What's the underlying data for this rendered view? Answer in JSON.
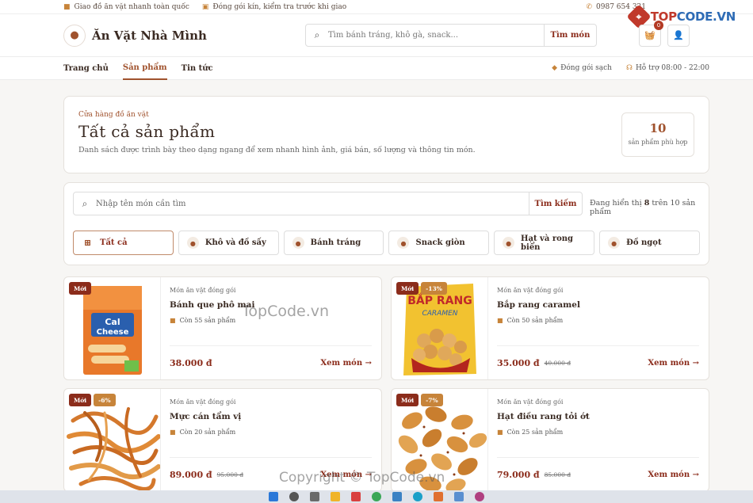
{
  "topbar": {
    "shipping": "Giao đồ ăn vặt nhanh toàn quốc",
    "packing": "Đóng gói kín, kiểm tra trước khi giao",
    "phone": "0987 654 321"
  },
  "brand_watermark": {
    "part1": "TOP",
    "part2": "CODE.VN"
  },
  "header": {
    "logo_text": "Ăn Vặt Nhà Mình",
    "search_placeholder": "Tìm bánh tráng, khô gà, snack...",
    "search_button": "Tìm món",
    "cart_count": "0"
  },
  "nav": {
    "links": [
      "Trang chủ",
      "Sản phẩm",
      "Tin tức"
    ],
    "meta_clean": "Đóng gói sạch",
    "meta_support": "Hỗ trợ 08:00 - 22:00"
  },
  "hero": {
    "kicker": "Cửa hàng đồ ăn vặt",
    "title": "Tất cả sản phẩm",
    "description": "Danh sách được trình bày theo dạng ngang để xem nhanh hình ảnh, giá bán, số lượng và thông tin món.",
    "count": "10",
    "count_label": "sản phẩm phù hợp"
  },
  "filter": {
    "placeholder": "Nhập tên món cần tìm",
    "button": "Tìm kiếm",
    "showing_prefix": "Đang hiển thị",
    "showing_count": "8",
    "showing_suffix": "trên 10 sản phẩm",
    "categories": [
      "Tất cả",
      "Khô và đồ sấy",
      "Bánh tráng",
      "Snack giòn",
      "Hạt và rong biển",
      "Đồ ngọt"
    ]
  },
  "products": [
    {
      "new": "Mới",
      "sale": "",
      "type": "Món ăn vặt đóng gói",
      "name": "Bánh que phô mai",
      "stock": "Còn 55 sản phẩm",
      "price": "38.000 đ",
      "old_price": "",
      "more": "Xem món"
    },
    {
      "new": "Mới",
      "sale": "-13%",
      "type": "Món ăn vặt đóng gói",
      "name": "Bắp rang caramel",
      "stock": "Còn 50 sản phẩm",
      "price": "35.000 đ",
      "old_price": "40.000 đ",
      "more": "Xem món"
    },
    {
      "new": "Mới",
      "sale": "-6%",
      "type": "Món ăn vặt đóng gói",
      "name": "Mực cán tẩm vị",
      "stock": "Còn 20 sản phẩm",
      "price": "89.000 đ",
      "old_price": "95.000 đ",
      "more": "Xem món"
    },
    {
      "new": "Mới",
      "sale": "-7%",
      "type": "Món ăn vặt đóng gói",
      "name": "Hạt điều rang tỏi ớt",
      "stock": "Còn 25 sản phẩm",
      "price": "79.000 đ",
      "old_price": "85.000 đ",
      "more": "Xem món"
    }
  ],
  "product_images": [
    {
      "package_text1": "Cal",
      "package_text2": "Cheese"
    },
    {
      "package_text1": "BẮP RANG",
      "package_text2": "CARAMEN"
    }
  ],
  "watermarks": {
    "center": "TopCode.vn",
    "bottom": "Copyright © TopCode.vn"
  },
  "colors": {
    "accent": "#8b2c1b",
    "brand": "#a0522d",
    "highlight": "#c7843a",
    "background": "#f7f6f4"
  }
}
